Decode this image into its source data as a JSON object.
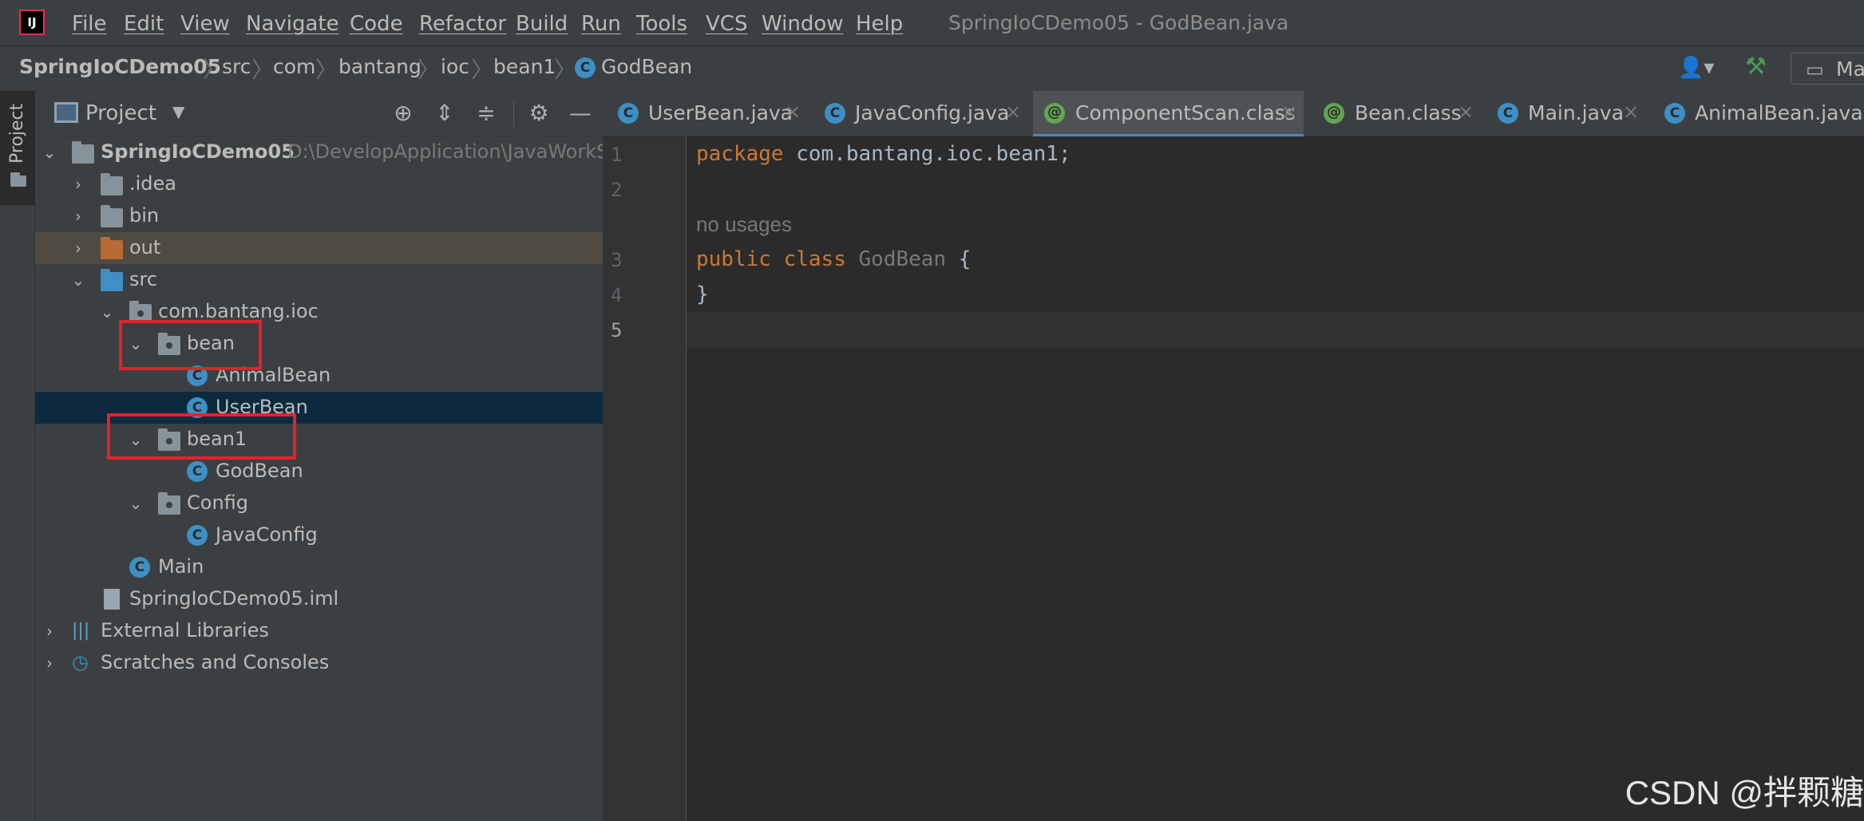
{
  "menubar": {
    "items": [
      "File",
      "Edit",
      "View",
      "Navigate",
      "Code",
      "Refactor",
      "Build",
      "Run",
      "Tools",
      "VCS",
      "Window",
      "Help"
    ],
    "window_title": "SpringIoCDemo05 - GodBean.java"
  },
  "breadcrumb": [
    "SpringIoCDemo05",
    "src",
    "com",
    "bantang",
    "ioc",
    "bean1",
    "GodBean"
  ],
  "toolbar": {
    "run_config_label": "Ma"
  },
  "sidebar": {
    "stripe_label": "Project"
  },
  "project_panel": {
    "title": "Project",
    "tree": [
      {
        "label": "SpringIoCDemo05",
        "path": "D:\\DevelopApplication\\JavaWorkS"
      },
      {
        "label": ".idea"
      },
      {
        "label": "bin"
      },
      {
        "label": "out"
      },
      {
        "label": "src"
      },
      {
        "label": "com.bantang.ioc"
      },
      {
        "label": "bean"
      },
      {
        "label": "AnimalBean"
      },
      {
        "label": "UserBean"
      },
      {
        "label": "bean1"
      },
      {
        "label": "GodBean"
      },
      {
        "label": "Config"
      },
      {
        "label": "JavaConfig"
      },
      {
        "label": "Main"
      },
      {
        "label": "SpringIoCDemo05.iml"
      },
      {
        "label": "External Libraries"
      },
      {
        "label": "Scratches and Consoles"
      }
    ]
  },
  "tabs": [
    {
      "label": "UserBean.java",
      "icon": "class-icon"
    },
    {
      "label": "JavaConfig.java",
      "icon": "class-icon"
    },
    {
      "label": "ComponentScan.class",
      "icon": "annotation-icon"
    },
    {
      "label": "Bean.class",
      "icon": "annotation-icon"
    },
    {
      "label": "Main.java",
      "icon": "class-icon"
    },
    {
      "label": "AnimalBean.java",
      "icon": "class-icon"
    }
  ],
  "editor": {
    "line_numbers": [
      "1",
      "2",
      "3",
      "4",
      "5"
    ],
    "code": {
      "line1_kw": "package",
      "line1_rest": " com.bantang.ioc.bean1;",
      "usage_hint": "no usages",
      "line3_kw1": "public",
      "line3_kw2": "class",
      "line3_name": "GodBean",
      "line3_brace": " {",
      "line4": "}"
    }
  },
  "watermark": "CSDN @拌颗糖",
  "colors": {
    "background": "#2b2b2b",
    "panel": "#3c3f41",
    "keyword": "#cc7832",
    "selection": "#0d293e",
    "highlight_box": "#e4222b"
  }
}
